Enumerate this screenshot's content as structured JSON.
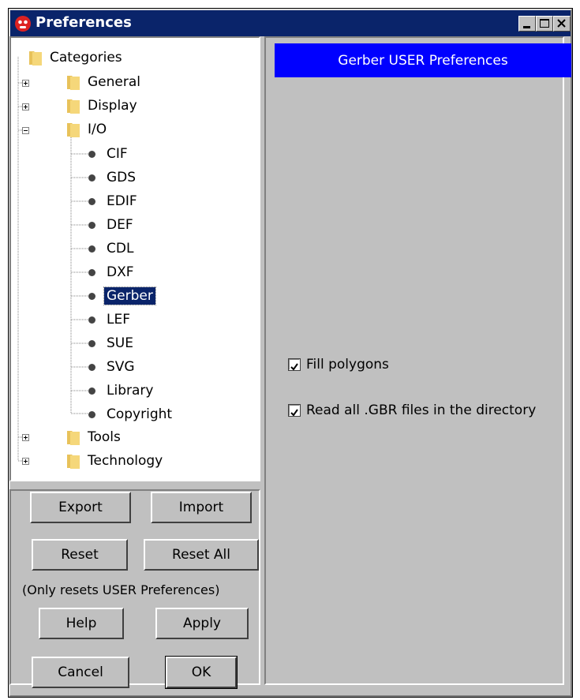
{
  "window": {
    "title": "Preferences"
  },
  "tree": {
    "root": "Categories",
    "general": "General",
    "display": "Display",
    "io": "I/O",
    "io_items": [
      "CIF",
      "GDS",
      "EDIF",
      "DEF",
      "CDL",
      "DXF",
      "Gerber",
      "LEF",
      "SUE",
      "SVG",
      "Library",
      "Copyright"
    ],
    "selected": "Gerber",
    "tools": "Tools",
    "technology": "Technology"
  },
  "buttons": {
    "export": "Export",
    "import": "Import",
    "reset": "Reset",
    "reset_all": "Reset All",
    "reset_note": "(Only resets USER Preferences)",
    "help": "Help",
    "apply": "Apply",
    "cancel": "Cancel",
    "ok": "OK"
  },
  "panel": {
    "header": "Gerber USER Preferences",
    "options": [
      {
        "label": "Fill polygons",
        "checked": true
      },
      {
        "label": "Read all .GBR files in the directory",
        "checked": true
      }
    ]
  },
  "colors": {
    "titlebar": "#0a246a",
    "panel_header": "#0000ff",
    "face": "#c0c0c0"
  }
}
